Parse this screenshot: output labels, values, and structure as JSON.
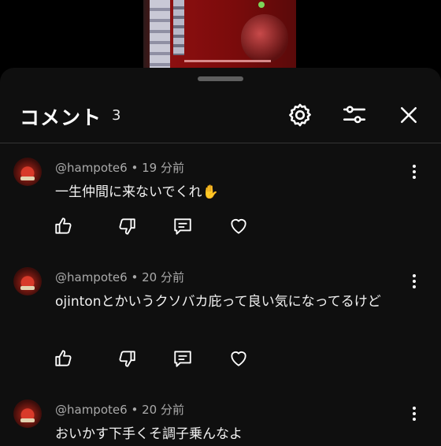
{
  "header": {
    "title": "コメント",
    "count": "3"
  },
  "comments": [
    {
      "author": "@hampote6",
      "separator": "•",
      "time": "19 分前",
      "text": "一生仲間に来ないでくれ✋"
    },
    {
      "author": "@hampote6",
      "separator": "•",
      "time": "20 分前",
      "text": "ojintonとかいうクソバカ庇って良い気になってるけど"
    },
    {
      "author": "@hampote6",
      "separator": "•",
      "time": "20 分前",
      "text": "おいかす下手くそ調子乗んなよ"
    }
  ],
  "icons": {
    "settings": "gear-icon",
    "filter": "sliders-icon",
    "close": "close-icon",
    "like": "thumbs-up-icon",
    "dislike": "thumbs-down-icon",
    "reply": "reply-icon",
    "heart": "heart-icon",
    "more": "more-vertical-icon"
  }
}
